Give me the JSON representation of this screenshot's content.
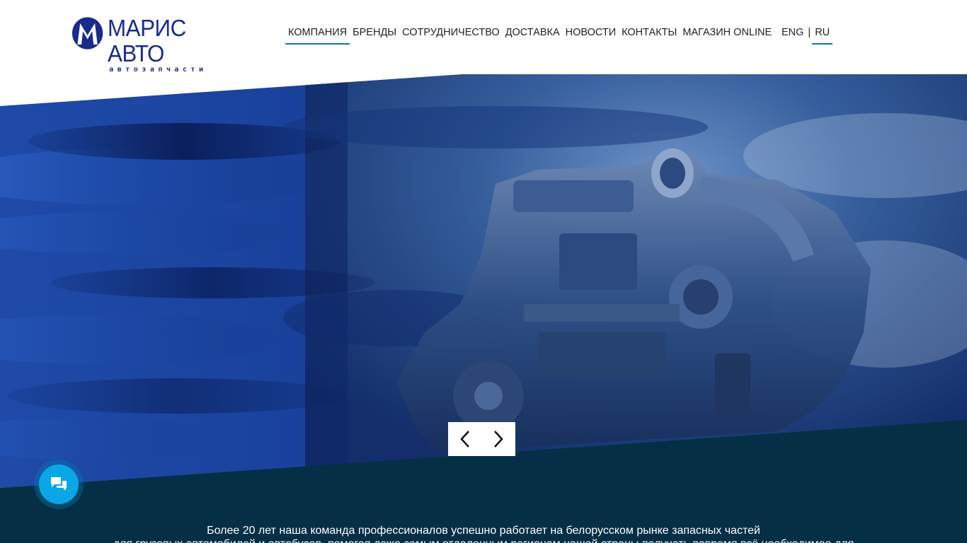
{
  "brand": {
    "name": "МАРИС АВТО",
    "subtitle": "автозапчасти"
  },
  "nav": {
    "items": [
      {
        "label": "КОМПАНИЯ",
        "active": true
      },
      {
        "label": "БРЕНДЫ",
        "active": false
      },
      {
        "label": "СОТРУДНИЧЕСТВО",
        "active": false
      },
      {
        "label": "ДОСТАВКА",
        "active": false
      },
      {
        "label": "НОВОСТИ",
        "active": false
      },
      {
        "label": "КОНТАКТЫ",
        "active": false
      },
      {
        "label": "МАГАЗИН ONLINE",
        "active": false
      }
    ]
  },
  "lang": {
    "options": [
      "ENG",
      "RU"
    ],
    "separator": "|",
    "selected": "RU"
  },
  "slider": {
    "prev_icon": "chevron-left-icon",
    "next_icon": "chevron-right-icon"
  },
  "chat": {
    "icon": "chat-bubbles-icon"
  },
  "intro": {
    "line1": "Более 20 лет наша команда профессионалов успешно работает на белорусском рынке запасных частей",
    "line2": "для грузовых автомобилей и автобусов, помогая даже самым отдаленным регионам нашей страны получать вовремя всё необходимое для"
  },
  "colors": {
    "brand_blue": "#1a2b8c",
    "nav_underline": "#1a6fb0",
    "band_dark": "#042f45",
    "chat_blue": "#0aa7e6"
  }
}
